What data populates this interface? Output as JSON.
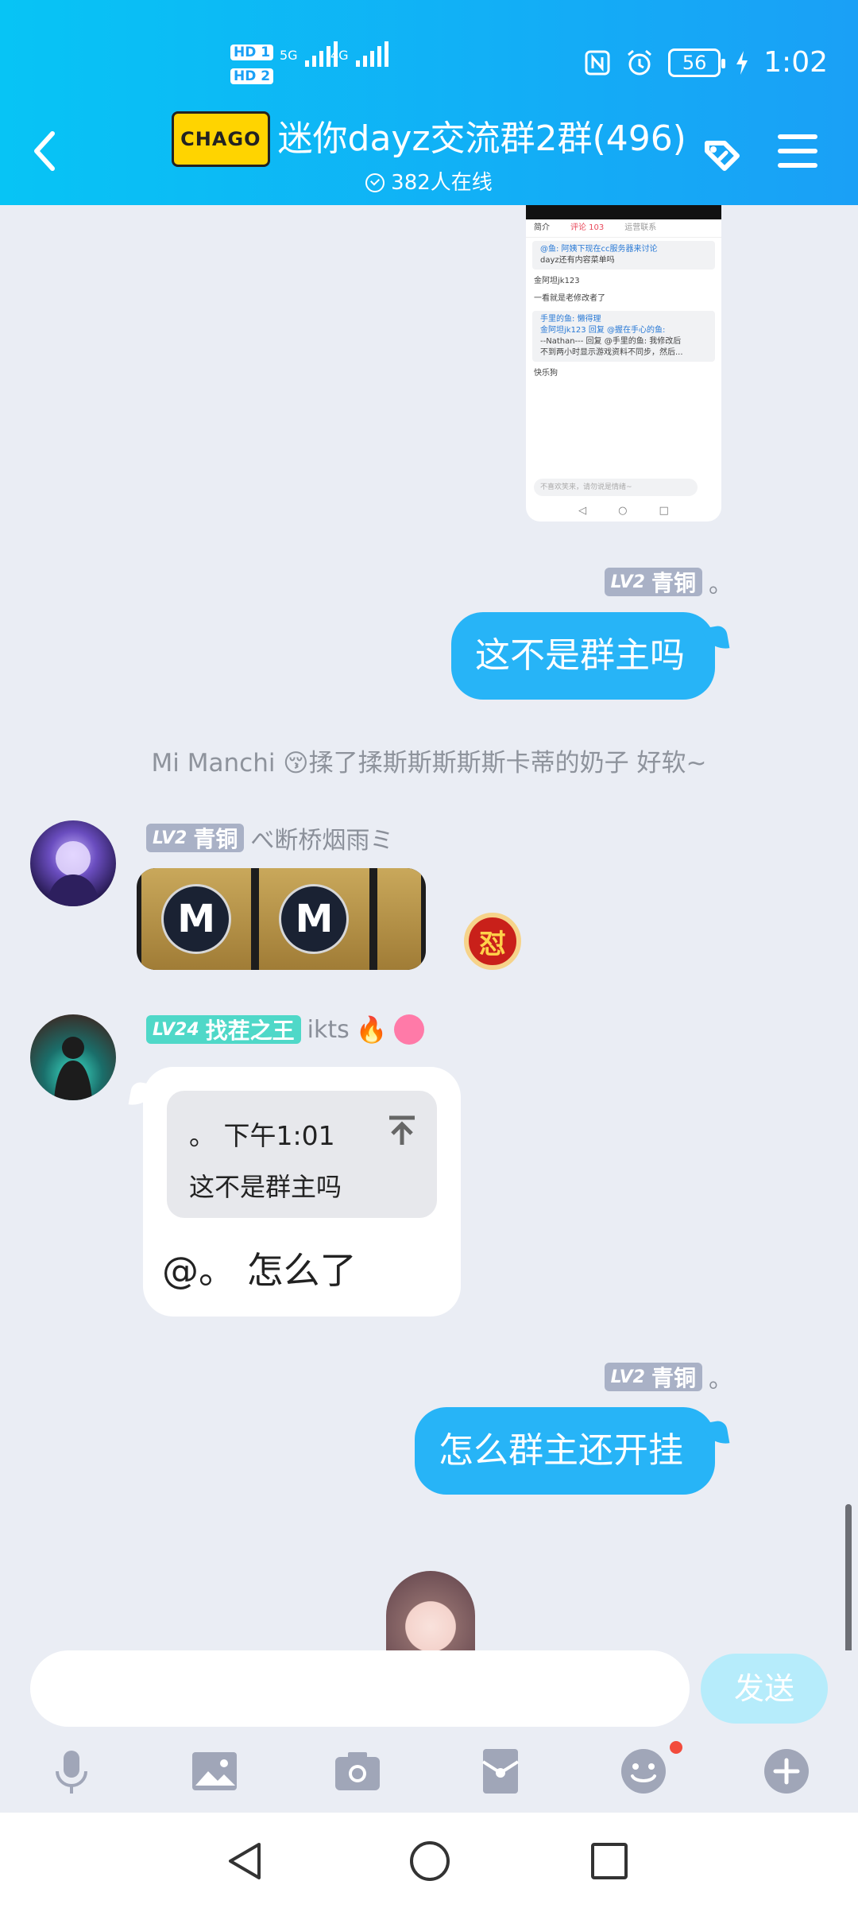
{
  "status_bar": {
    "sim1": "HD 1",
    "sim2": "HD 2",
    "net1": "5G",
    "net2": "4G",
    "battery": "56",
    "time": "1:02"
  },
  "header": {
    "logo_text": "CHAGO",
    "title": "迷你dayz交流群2群(496)",
    "online": "382人在线"
  },
  "shot": {
    "tabs": [
      "简介",
      "评论 103",
      "运营联系"
    ],
    "lines": [
      "@鱼: 阿姨下现在cc服务器来讨论",
      "dayz还有内容菜单吗",
      "金阿坦jk123",
      "一看就是老修改者了",
      "手里的鱼: 懒得理",
      "金阿坦jk123 回复 @握在手心的鱼:",
      "--Nathan--- 回复 @手里的鱼: 我修改后",
      "不到两小时显示游戏资料不同步，然后...",
      "快乐狗"
    ],
    "input_placeholder": "不喜欢笑来，请勿说是情绪~"
  },
  "messages": {
    "me1": {
      "level": "LV2",
      "rank": "青铜",
      "name": "。",
      "text": "这不是群主吗"
    },
    "system": "Mi Manchi 😚揉了揉斯斯斯斯斯卡蒂的奶子 好软~",
    "user1": {
      "level": "LV2",
      "rank": "青铜",
      "name": "べ断桥烟雨ミ",
      "image_letter": "M",
      "sticker": "怼"
    },
    "user2": {
      "level": "LV24",
      "rank": "找茬之王",
      "name": "ikts",
      "quote_header": "。 下午1:01",
      "quote_text": "这不是群主吗",
      "reply": "@。 怎么了"
    },
    "me2": {
      "level": "LV2",
      "rank": "青铜",
      "name": "。",
      "text": "怎么群主还开挂"
    }
  },
  "input": {
    "placeholder": "",
    "send_label": "发送"
  },
  "colors": {
    "header": "#1aa0f6",
    "bubble": "#27b4f7",
    "send_disabled": "#b6ecfb"
  }
}
